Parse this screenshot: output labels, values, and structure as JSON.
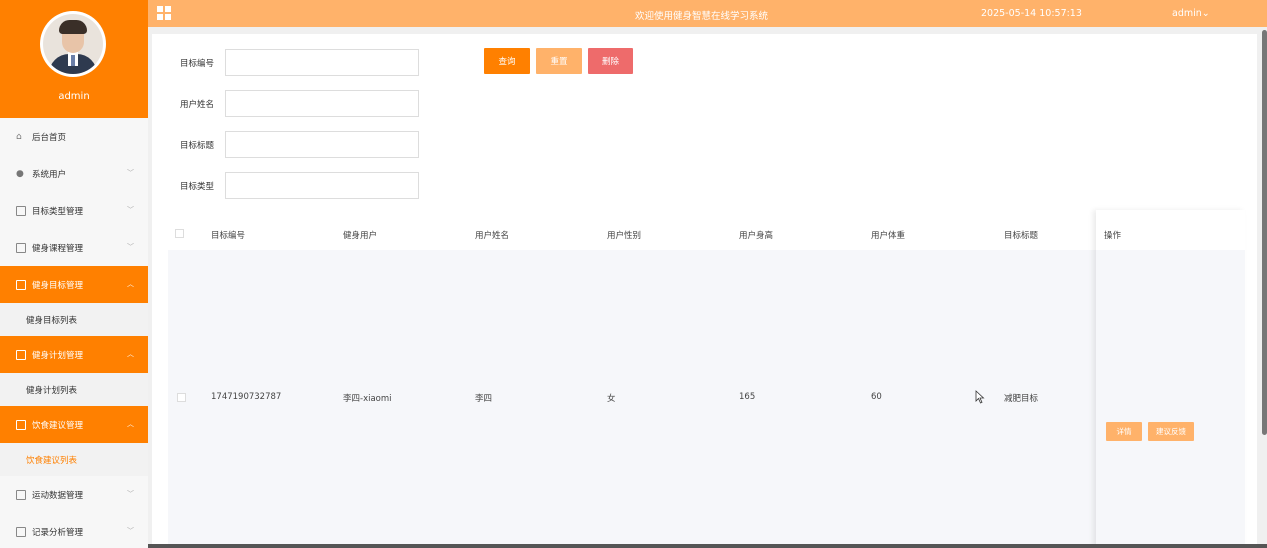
{
  "sidebar": {
    "username": "admin",
    "items": [
      {
        "label": "后台首页"
      },
      {
        "label": "系统用户"
      },
      {
        "label": "目标类型管理"
      },
      {
        "label": "健身课程管理"
      },
      {
        "label": "健身目标管理",
        "sub": "健身目标列表"
      },
      {
        "label": "健身计划管理",
        "sub": "健身计划列表"
      },
      {
        "label": "饮食建议管理",
        "sub": "饮食建议列表"
      },
      {
        "label": "运动数据管理"
      },
      {
        "label": "记录分析管理"
      }
    ]
  },
  "topbar": {
    "title": "欢迎使用健身智慧在线学习系统",
    "time": "2025-05-14 10:57:13",
    "user": "admin⌄"
  },
  "search": {
    "fields": [
      {
        "label": "目标编号",
        "value": ""
      },
      {
        "label": "用户姓名",
        "value": ""
      },
      {
        "label": "目标标题",
        "value": ""
      },
      {
        "label": "目标类型",
        "value": ""
      }
    ],
    "query": "查询",
    "reset": "重置",
    "delete": "删除"
  },
  "table": {
    "headers": [
      "目标编号",
      "健身用户",
      "用户姓名",
      "用户性别",
      "用户身高",
      "用户体重",
      "目标标题",
      "操作"
    ],
    "rows": [
      [
        "1747190732787",
        "李四-xiaomi",
        "李四",
        "女",
        "165",
        "60",
        "减肥目标"
      ]
    ],
    "actions": [
      "详情",
      "建议反馈"
    ]
  },
  "colors": {
    "accent": "#ff8000",
    "topbar": "#ffb26a",
    "danger": "#ee6b6b"
  }
}
